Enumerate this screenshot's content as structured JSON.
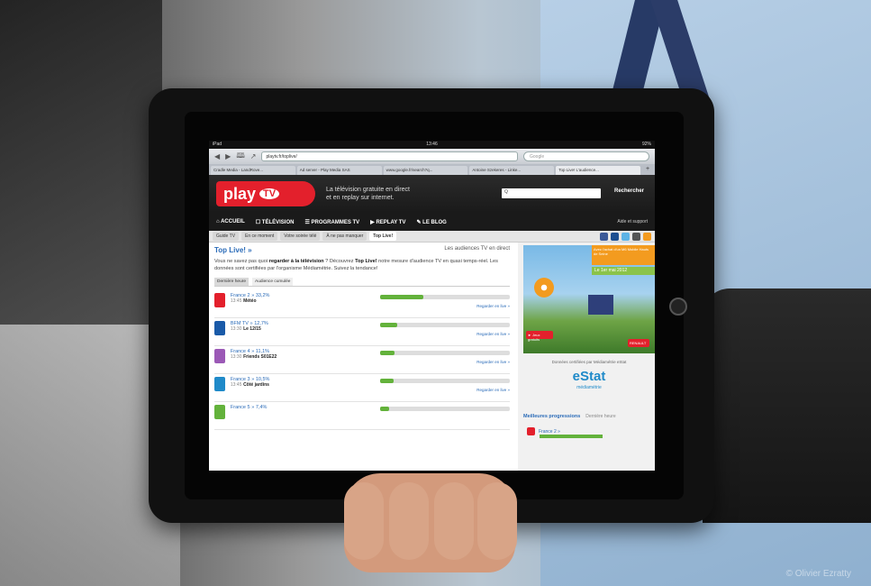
{
  "watermark": "© Olivier Ezratty",
  "ios": {
    "carrier": "iPad",
    "time": "13:46",
    "battery": "92%"
  },
  "safari": {
    "back": "◀",
    "forward": "▶",
    "bookmarks": "🕮",
    "share": "↗",
    "url": "playtv.fr/toplive/",
    "search_placeholder": "Google",
    "tabs": [
      "Cradle Media - LandRove...",
      "Ad server - Play Media SAS",
      "www.google.fr/search?q...",
      "Antoine Szekeres - Linke...",
      "Top Live! L'audience..."
    ],
    "tab_plus": "+"
  },
  "site": {
    "logo_play": "play",
    "logo_tv": "TV",
    "tagline_1": "La télévision gratuite en direct",
    "tagline_2": "et en replay sur internet.",
    "search_label": "Q",
    "search_button": "Rechercher",
    "nav": [
      "⌂ ACCUEIL",
      "☐ TÉLÉVISION",
      "☰ PROGRAMMES TV",
      "▶ REPLAY TV",
      "✎ LE BLOG"
    ],
    "help": "Aide et support",
    "subtabs": [
      "Guide TV",
      "En ce moment",
      "Votre soirée télé",
      "À ne pas manquer",
      "Top Live!"
    ],
    "active_subtab": 4
  },
  "main": {
    "title": "Top Live! »",
    "title_right": "Les audiences TV en direct",
    "intro_a": "Vous ne savez pas quoi ",
    "intro_b": "regarder à la télévision",
    "intro_c": " ? Découvrez ",
    "intro_d": "Top Live!",
    "intro_e": " notre mesure d'audience TV en quasi temps-réel. Les données sont certifiées par l'organisme Médiamétrie. Suivez la tendance!",
    "mini_tabs": [
      "Dernière heure",
      "Audience cumulée"
    ],
    "rows": [
      {
        "channel": "France 2",
        "share": "» 33,2%",
        "time": "13:45",
        "program": "Météo",
        "pct": 0.33,
        "color": "#e3202c",
        "cta": "Regarder en live »"
      },
      {
        "channel": "BFM TV",
        "share": "» 12,7%",
        "time": "13:30",
        "program": "Le 12/15",
        "pct": 0.13,
        "color": "#1a5aa8",
        "cta": "Regarder en live »"
      },
      {
        "channel": "France 4",
        "share": "» 11,1%",
        "time": "13:30",
        "program": "Friends S01E22",
        "pct": 0.11,
        "color": "#9b59b6",
        "cta": "Regarder en live »"
      },
      {
        "channel": "France 3",
        "share": "» 10,5%",
        "time": "13:45",
        "program": "Côté jardins",
        "pct": 0.1,
        "color": "#1f8ac9",
        "cta": "Regarder en live »"
      },
      {
        "channel": "France 5",
        "share": "» 7,4%",
        "time": "",
        "program": "",
        "pct": 0.07,
        "color": "#63b23b",
        "cta": ""
      }
    ]
  },
  "sidebar": {
    "ad_banner": "Avec l'achat d'un M6 Mobile Hauts de Seine",
    "ad_date": "Le 1er mai 2012",
    "ad_button": "► Jeux gratuits",
    "ad_button2": "RENAULT",
    "estat_label": "Données certifiées par Médiamétrie eStat",
    "estat": "eStat",
    "estat_sub": "médiamétrie",
    "best_title": "Meilleures progressions",
    "best_sub": "Dernière heure",
    "best_channel": "France 2 »"
  }
}
